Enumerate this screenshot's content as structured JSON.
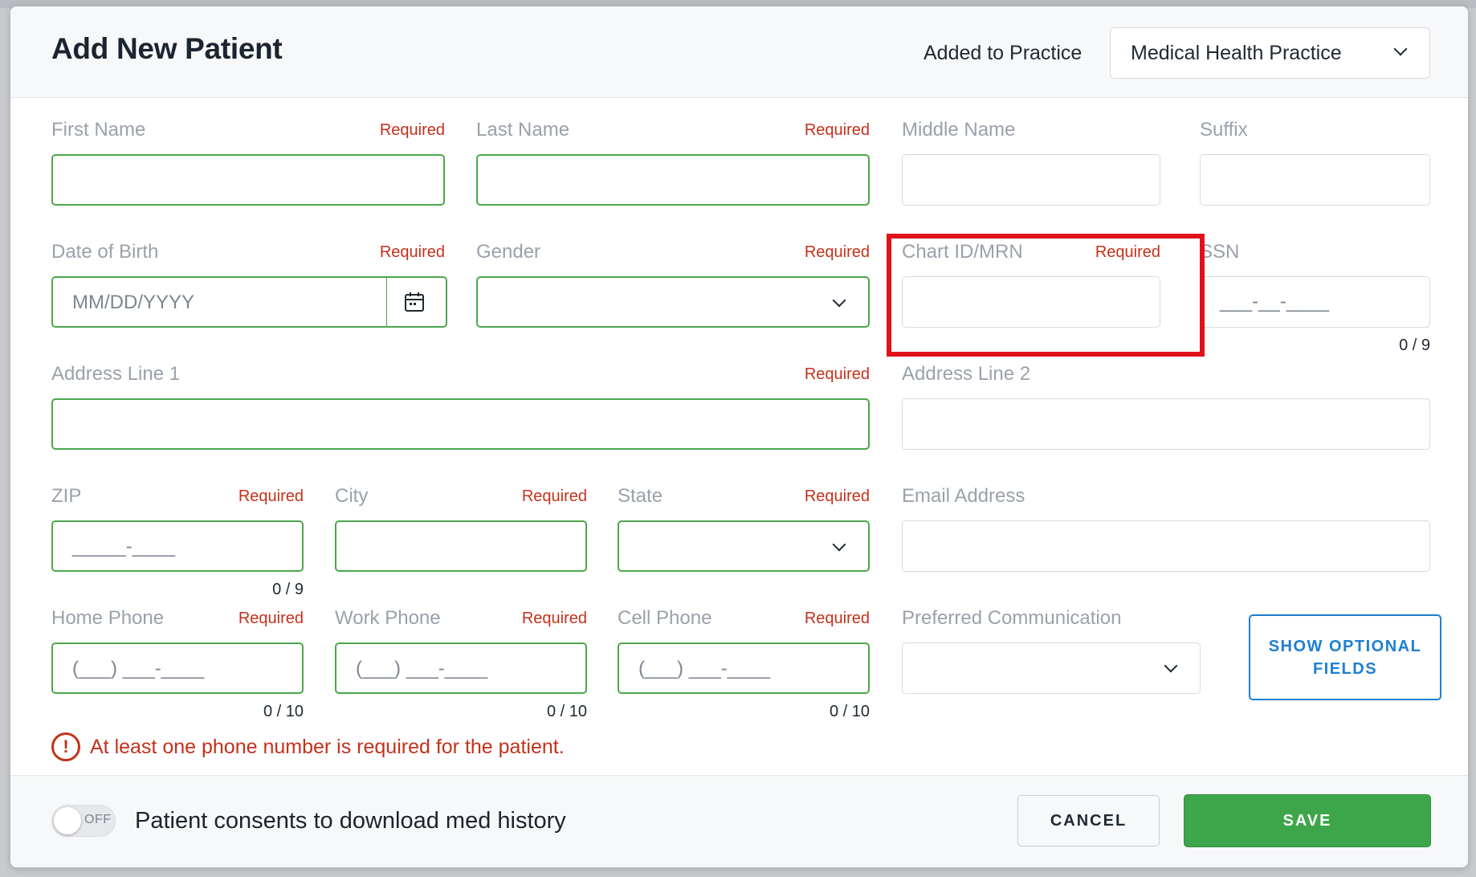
{
  "modal": {
    "title": "Add New Patient",
    "practice_label": "Added to Practice",
    "practice_value": "Medical Health Practice"
  },
  "required_label": "Required",
  "fields": {
    "first_name": {
      "label": "First Name",
      "required": true,
      "value": ""
    },
    "last_name": {
      "label": "Last Name",
      "required": true,
      "value": ""
    },
    "middle_name": {
      "label": "Middle Name",
      "required": false,
      "value": ""
    },
    "suffix": {
      "label": "Suffix",
      "required": false,
      "value": ""
    },
    "dob": {
      "label": "Date of Birth",
      "required": true,
      "placeholder": "MM/DD/YYYY"
    },
    "gender": {
      "label": "Gender",
      "required": true,
      "value": ""
    },
    "chart_id": {
      "label": "Chart ID/MRN",
      "required": true,
      "value": ""
    },
    "ssn": {
      "label": "SSN",
      "required": false,
      "placeholder": "___-__-____",
      "counter": "0 / 9"
    },
    "address1": {
      "label": "Address Line 1",
      "required": true,
      "value": ""
    },
    "address2": {
      "label": "Address Line 2",
      "required": false,
      "value": ""
    },
    "zip": {
      "label": "ZIP",
      "required": true,
      "placeholder": "_____-____",
      "counter": "0 / 9"
    },
    "city": {
      "label": "City",
      "required": true,
      "value": ""
    },
    "state": {
      "label": "State",
      "required": true,
      "value": ""
    },
    "email": {
      "label": "Email Address",
      "required": false,
      "value": ""
    },
    "home_phone": {
      "label": "Home Phone",
      "required": true,
      "placeholder": "(___) ___-____",
      "counter": "0 / 10"
    },
    "work_phone": {
      "label": "Work Phone",
      "required": true,
      "placeholder": "(___) ___-____",
      "counter": "0 / 10"
    },
    "cell_phone": {
      "label": "Cell Phone",
      "required": true,
      "placeholder": "(___) ___-____",
      "counter": "0 / 10"
    },
    "preferred_comm": {
      "label": "Preferred Communication",
      "required": false,
      "value": ""
    }
  },
  "show_optional_label": "SHOW OPTIONAL FIELDS",
  "error": {
    "icon": "!",
    "message": "At least one phone number is required for the patient."
  },
  "footer": {
    "toggle_state": "OFF",
    "consent_text": "Patient consents to download med history",
    "cancel_label": "CANCEL",
    "save_label": "SAVE"
  },
  "colors": {
    "required_red": "#c4311b",
    "valid_green": "#4aa84a",
    "save_green": "#3da54a",
    "link_blue": "#1e7fd1",
    "highlight_red": "#e0111b"
  },
  "icons": {
    "dob_button": "calendar-icon",
    "dropdown": "chevron-down-icon",
    "error": "error-circle-icon"
  }
}
